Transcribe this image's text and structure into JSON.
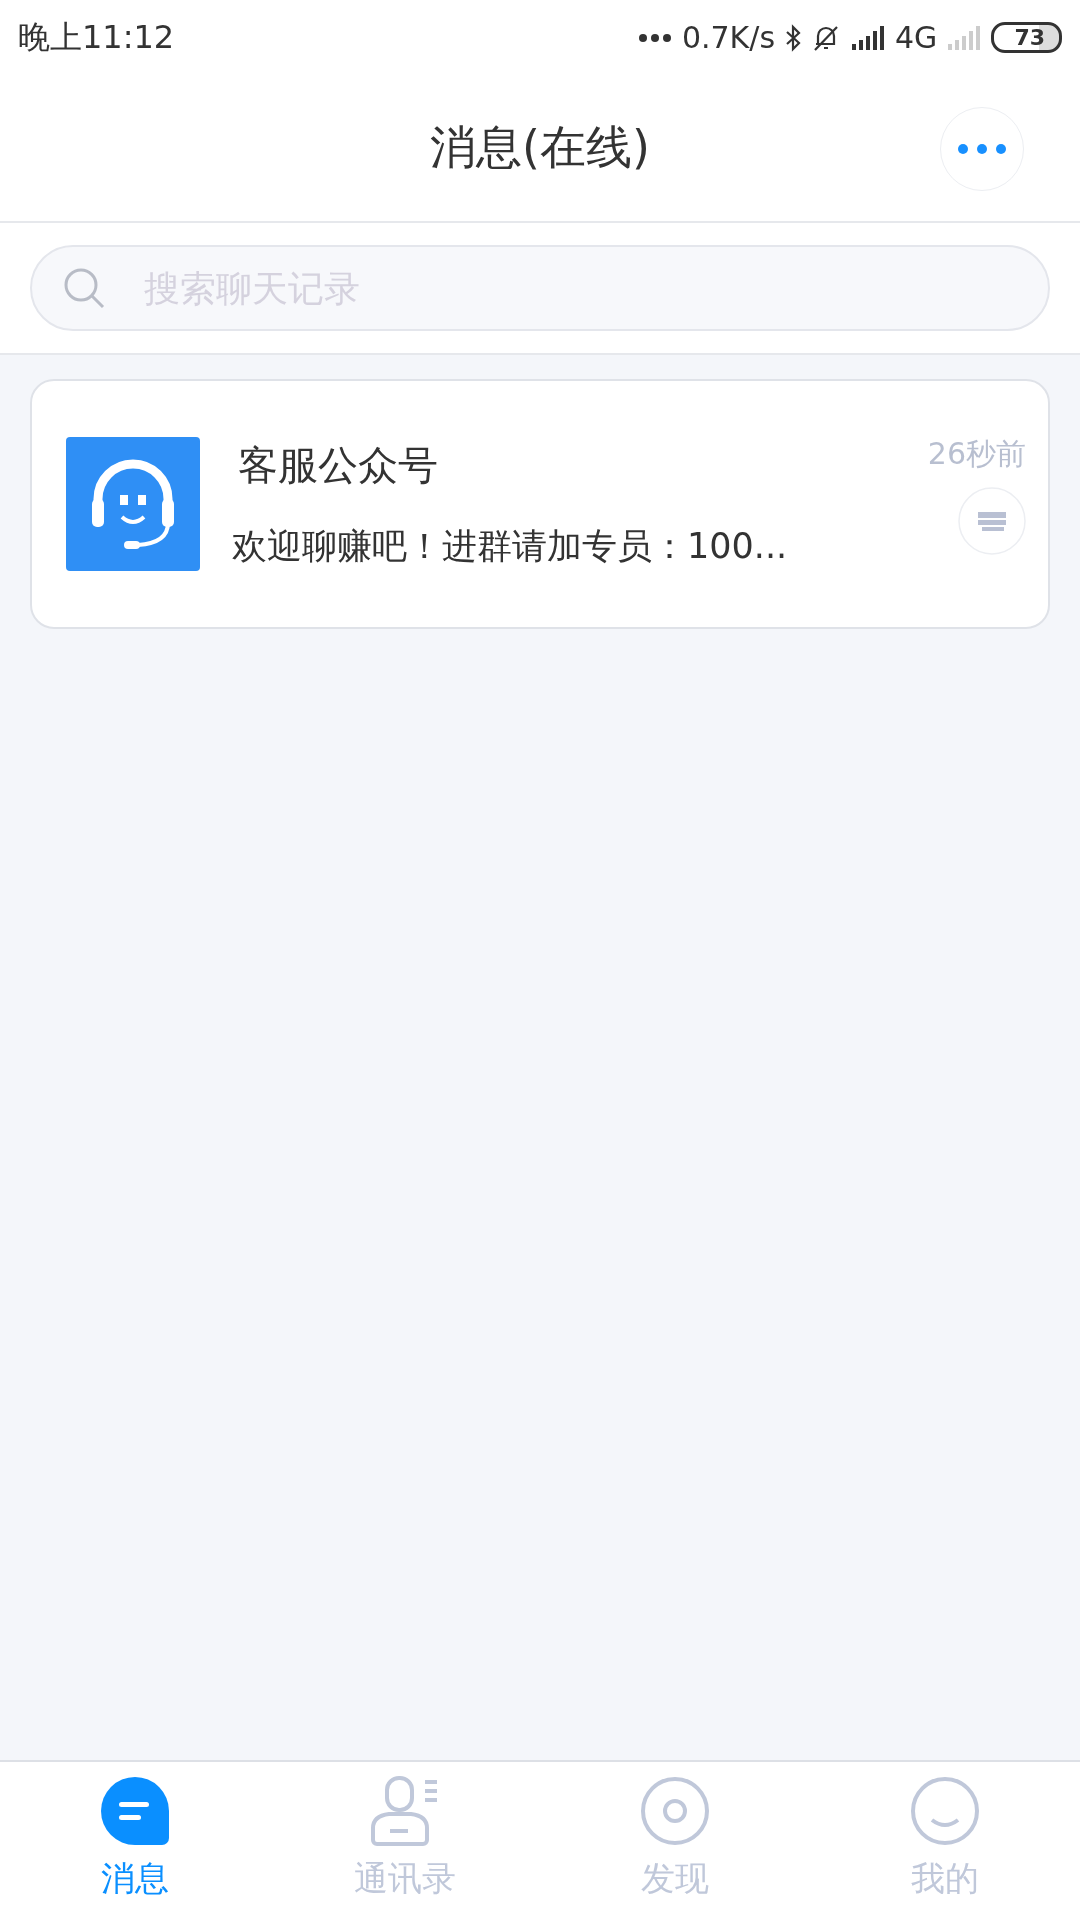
{
  "status_bar": {
    "time": "晚上11:12",
    "net_speed": "0.7K/s",
    "network": "4G",
    "battery": "73"
  },
  "header": {
    "title": "消息(在线)"
  },
  "search": {
    "placeholder": "搜索聊天记录"
  },
  "conversations": [
    {
      "name": "客服公众号",
      "preview": "欢迎聊赚吧！进群请加专员：100...",
      "time": "26秒前"
    }
  ],
  "tabs": [
    {
      "kind": "chat",
      "label": "消息",
      "selected": true
    },
    {
      "kind": "contacts",
      "label": "通讯录",
      "selected": false
    },
    {
      "kind": "discover",
      "label": "发现",
      "selected": false
    },
    {
      "kind": "me",
      "label": "我的",
      "selected": false
    }
  ]
}
